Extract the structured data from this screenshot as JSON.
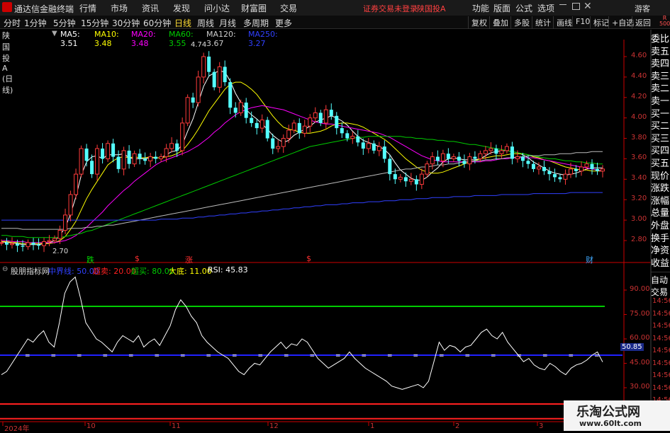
{
  "app_title": "通达信金融终端",
  "menu": [
    "行情",
    "市场",
    "资讯",
    "发现",
    "问小达",
    "财富圈",
    "交易"
  ],
  "warning": "证券交易未登录",
  "stock_title": "陕国投A",
  "right_menu": [
    "功能",
    "版面",
    "公式",
    "选项"
  ],
  "guest": "游客",
  "periods": [
    "分时",
    "1分钟",
    "5分钟",
    "15分钟",
    "30分钟",
    "60分钟",
    "日线",
    "周线",
    "月线",
    "多周期",
    "更多"
  ],
  "active_period": "日线",
  "toolbar": [
    "复权",
    "叠加",
    "多股",
    "统计",
    "画线",
    "F10",
    "标记",
    "+自选",
    "返回"
  ],
  "info": {
    "name": "陕国投A (日线)",
    "ma5": "MA5: 3.51",
    "ma10": "MA10: 3.48",
    "ma20": "MA20: 3.48",
    "ma60": "MA60: 3.55",
    "ma120": "MA120: 3.67",
    "ma250": "MA250: 3.27"
  },
  "side_labels": [
    "委比",
    "卖五",
    "卖四",
    "卖三",
    "卖二",
    "卖一",
    "买一",
    "买二",
    "买三",
    "买四",
    "买五",
    "现价",
    "涨跌",
    "涨幅",
    "总量",
    "外盘",
    "换手",
    "净资",
    "收益"
  ],
  "side_labels2": [
    "自动",
    "交易"
  ],
  "price_axis": [
    "4.60",
    "4.40",
    "4.20",
    "4.00",
    "3.80",
    "3.60",
    "3.40",
    "3.20",
    "3.00",
    "2.80"
  ],
  "rsi_axis": [
    "90.00",
    "75.00",
    "60.00",
    "45.00",
    "30.00"
  ],
  "rsi_current_tag": "50.85",
  "time_stubs": [
    "14:56",
    "14:56",
    "14:56",
    "14:56",
    "14:56",
    "14:56",
    "14:56",
    "14:56",
    "14:56",
    "14:56",
    "14:56"
  ],
  "r_badge": "R\n500",
  "markers": [
    "跌",
    "$",
    "涨",
    "$",
    "财"
  ],
  "high_label": "4.74",
  "low_label": "2.70",
  "indicator": {
    "name": "股朋指标网",
    "midline": "中界线: 50.00",
    "oversold": "超卖: 20.00",
    "overbought": "超买: 80.00",
    "bottom": "大底: 11.00",
    "rsi": "RSI: 45.83"
  },
  "x_axis": [
    "2024年",
    "10",
    "11",
    "12",
    "1",
    "2",
    "3"
  ],
  "watermark": {
    "title": "乐淘公式网",
    "url": "www.60lt.com"
  },
  "colors": {
    "up": "#ff3b3b",
    "down": "#54ffff",
    "ma5": "#ffffff",
    "ma10": "#ffff00",
    "ma20": "#ff00ff",
    "ma60": "#00cc00",
    "ma120": "#bbbbbb",
    "ma250": "#3040ff",
    "midline": "#2020ff",
    "overbought": "#00cc00",
    "oversold": "#ff2020"
  },
  "chart_data": [
    {
      "type": "candlestick",
      "title": "陕国投A (日线)",
      "ylim": [
        2.7,
        4.74
      ],
      "y_ticks": [
        4.6,
        4.4,
        4.2,
        4.0,
        3.8,
        3.6,
        3.4,
        3.2,
        3.0,
        2.8
      ],
      "x_labels": [
        "2024年",
        "10",
        "11",
        "12",
        "1",
        "2",
        "3"
      ],
      "high": 4.74,
      "low": 2.7,
      "closes": [
        2.78,
        2.76,
        2.77,
        2.75,
        2.74,
        2.78,
        2.76,
        2.75,
        2.79,
        2.8,
        2.82,
        2.9,
        3.05,
        3.25,
        3.45,
        3.7,
        3.58,
        3.45,
        3.7,
        3.6,
        3.75,
        3.62,
        3.5,
        3.68,
        3.55,
        3.65,
        3.6,
        3.58,
        3.62,
        3.6,
        3.62,
        3.7,
        3.75,
        3.68,
        3.95,
        4.2,
        4.15,
        4.4,
        4.6,
        4.45,
        4.3,
        4.5,
        4.35,
        4.1,
        4.05,
        4.15,
        4.0,
        3.95,
        3.9,
        3.98,
        3.8,
        3.7,
        3.72,
        3.8,
        3.88,
        3.95,
        3.85,
        3.92,
        4.0,
        4.05,
        3.95,
        4.08,
        4.02,
        3.9,
        3.85,
        3.8,
        3.82,
        3.76,
        3.7,
        3.75,
        3.68,
        3.72,
        3.6,
        3.45,
        3.4,
        3.42,
        3.38,
        3.4,
        3.35,
        3.45,
        3.55,
        3.62,
        3.58,
        3.65,
        3.6,
        3.62,
        3.58,
        3.55,
        3.62,
        3.6,
        3.65,
        3.68,
        3.7,
        3.65,
        3.68,
        3.72,
        3.6,
        3.62,
        3.58,
        3.55,
        3.5,
        3.52,
        3.48,
        3.45,
        3.42,
        3.4,
        3.45,
        3.5,
        3.48,
        3.52,
        3.55,
        3.5,
        3.48,
        3.5
      ],
      "series": [
        {
          "name": "MA5",
          "values": [
            2.79,
            2.78,
            2.78,
            2.77,
            2.76,
            2.76,
            2.76,
            2.76,
            2.77,
            2.78,
            2.8,
            2.85,
            2.93,
            3.06,
            3.23,
            3.44,
            3.57,
            3.62,
            3.63,
            3.6,
            3.64,
            3.64,
            3.64,
            3.65,
            3.61,
            3.6,
            3.6,
            3.6,
            3.61,
            3.61,
            3.61,
            3.64,
            3.67,
            3.68,
            3.74,
            3.87,
            3.99,
            4.15,
            4.31,
            4.41,
            4.44,
            4.46,
            4.45,
            4.36,
            4.24,
            4.15,
            4.08,
            4.03,
            3.99,
            3.94,
            3.89,
            3.83,
            3.79,
            3.76,
            3.78,
            3.83,
            3.86,
            3.89,
            3.92,
            3.96,
            3.98,
            4.0,
            4.02,
            4.0,
            3.97,
            3.93,
            3.87,
            3.82,
            3.78,
            3.76,
            3.74,
            3.72,
            3.69,
            3.64,
            3.56,
            3.49,
            3.45,
            3.41,
            3.39,
            3.39,
            3.42,
            3.47,
            3.51,
            3.57,
            3.6,
            3.61,
            3.6,
            3.59,
            3.59,
            3.59,
            3.6,
            3.63,
            3.66,
            3.67,
            3.68,
            3.68,
            3.67,
            3.66,
            3.64,
            3.61,
            3.57,
            3.54,
            3.51,
            3.48,
            3.46,
            3.45,
            3.44,
            3.45,
            3.46,
            3.48,
            3.5,
            3.51,
            3.51,
            3.51
          ]
        },
        {
          "name": "MA10",
          "values": [
            2.79,
            2.79,
            2.78,
            2.78,
            2.77,
            2.77,
            2.77,
            2.77,
            2.77,
            2.77,
            2.78,
            2.8,
            2.84,
            2.91,
            2.99,
            3.1,
            3.21,
            3.3,
            3.38,
            3.46,
            3.54,
            3.58,
            3.61,
            3.62,
            3.61,
            3.62,
            3.61,
            3.61,
            3.62,
            3.61,
            3.61,
            3.62,
            3.63,
            3.65,
            3.68,
            3.74,
            3.81,
            3.89,
            3.98,
            4.07,
            4.14,
            4.21,
            4.28,
            4.33,
            4.35,
            4.35,
            4.32,
            4.28,
            4.23,
            4.16,
            4.09,
            4.02,
            3.96,
            3.91,
            3.89,
            3.88,
            3.86,
            3.85,
            3.85,
            3.86,
            3.87,
            3.89,
            3.92,
            3.94,
            3.95,
            3.95,
            3.94,
            3.93,
            3.91,
            3.88,
            3.85,
            3.82,
            3.79,
            3.75,
            3.7,
            3.65,
            3.6,
            3.56,
            3.52,
            3.49,
            3.47,
            3.46,
            3.46,
            3.47,
            3.49,
            3.51,
            3.53,
            3.55,
            3.57,
            3.58,
            3.6,
            3.61,
            3.62,
            3.63,
            3.63,
            3.64,
            3.65,
            3.65,
            3.65,
            3.64,
            3.62,
            3.61,
            3.59,
            3.58,
            3.56,
            3.54,
            3.52,
            3.51,
            3.5,
            3.49,
            3.49,
            3.48,
            3.48,
            3.48
          ]
        },
        {
          "name": "MA20",
          "values": [
            2.8,
            2.8,
            2.79,
            2.79,
            2.79,
            2.78,
            2.78,
            2.78,
            2.78,
            2.78,
            2.78,
            2.79,
            2.8,
            2.82,
            2.85,
            2.89,
            2.93,
            2.98,
            3.03,
            3.08,
            3.14,
            3.19,
            3.24,
            3.29,
            3.33,
            3.38,
            3.42,
            3.46,
            3.5,
            3.54,
            3.57,
            3.59,
            3.61,
            3.63,
            3.65,
            3.67,
            3.7,
            3.73,
            3.77,
            3.81,
            3.86,
            3.9,
            3.95,
            3.99,
            4.03,
            4.06,
            4.08,
            4.1,
            4.11,
            4.12,
            4.11,
            4.1,
            4.09,
            4.08,
            4.06,
            4.04,
            4.02,
            4.0,
            3.98,
            3.96,
            3.95,
            3.94,
            3.94,
            3.93,
            3.92,
            3.91,
            3.9,
            3.89,
            3.88,
            3.87,
            3.86,
            3.85,
            3.83,
            3.81,
            3.78,
            3.75,
            3.72,
            3.69,
            3.66,
            3.63,
            3.61,
            3.59,
            3.58,
            3.57,
            3.57,
            3.57,
            3.57,
            3.57,
            3.57,
            3.57,
            3.57,
            3.58,
            3.58,
            3.59,
            3.6,
            3.6,
            3.61,
            3.61,
            3.61,
            3.61,
            3.61,
            3.6,
            3.59,
            3.58,
            3.57,
            3.56,
            3.55,
            3.54,
            3.53,
            3.52,
            3.51,
            3.5,
            3.49,
            3.48
          ]
        },
        {
          "name": "MA60",
          "values": [
            2.85,
            2.85,
            2.84,
            2.84,
            2.84,
            2.83,
            2.83,
            2.83,
            2.83,
            2.83,
            2.83,
            2.83,
            2.84,
            2.85,
            2.86,
            2.87,
            2.89,
            2.9,
            2.92,
            2.94,
            2.96,
            2.98,
            3.0,
            3.02,
            3.04,
            3.06,
            3.08,
            3.1,
            3.12,
            3.14,
            3.16,
            3.18,
            3.2,
            3.22,
            3.24,
            3.26,
            3.28,
            3.3,
            3.32,
            3.34,
            3.36,
            3.38,
            3.4,
            3.42,
            3.44,
            3.46,
            3.48,
            3.5,
            3.52,
            3.54,
            3.56,
            3.58,
            3.6,
            3.62,
            3.64,
            3.66,
            3.68,
            3.7,
            3.72,
            3.73,
            3.74,
            3.75,
            3.76,
            3.77,
            3.78,
            3.79,
            3.8,
            3.81,
            3.81,
            3.82,
            3.82,
            3.82,
            3.82,
            3.82,
            3.82,
            3.82,
            3.81,
            3.81,
            3.8,
            3.8,
            3.79,
            3.79,
            3.78,
            3.78,
            3.77,
            3.77,
            3.76,
            3.75,
            3.74,
            3.74,
            3.73,
            3.72,
            3.71,
            3.7,
            3.69,
            3.68,
            3.67,
            3.66,
            3.65,
            3.64,
            3.63,
            3.62,
            3.61,
            3.6,
            3.6,
            3.59,
            3.58,
            3.58,
            3.57,
            3.57,
            3.56,
            3.56,
            3.55,
            3.55
          ]
        },
        {
          "name": "MA120",
          "values": [
            2.92,
            2.92,
            2.92,
            2.92,
            2.91,
            2.91,
            2.91,
            2.91,
            2.91,
            2.91,
            2.91,
            2.91,
            2.91,
            2.92,
            2.92,
            2.92,
            2.93,
            2.93,
            2.94,
            2.94,
            2.95,
            2.95,
            2.96,
            2.97,
            2.98,
            2.99,
            3.0,
            3.01,
            3.02,
            3.03,
            3.04,
            3.05,
            3.06,
            3.07,
            3.08,
            3.09,
            3.1,
            3.11,
            3.12,
            3.13,
            3.14,
            3.15,
            3.16,
            3.17,
            3.18,
            3.19,
            3.2,
            3.21,
            3.22,
            3.23,
            3.24,
            3.25,
            3.26,
            3.27,
            3.28,
            3.29,
            3.3,
            3.31,
            3.32,
            3.33,
            3.34,
            3.35,
            3.36,
            3.37,
            3.38,
            3.39,
            3.4,
            3.41,
            3.42,
            3.43,
            3.44,
            3.45,
            3.46,
            3.47,
            3.48,
            3.49,
            3.5,
            3.5,
            3.51,
            3.52,
            3.52,
            3.53,
            3.54,
            3.54,
            3.55,
            3.55,
            3.56,
            3.57,
            3.57,
            3.58,
            3.58,
            3.59,
            3.59,
            3.6,
            3.6,
            3.61,
            3.61,
            3.62,
            3.62,
            3.63,
            3.63,
            3.63,
            3.64,
            3.64,
            3.64,
            3.65,
            3.65,
            3.65,
            3.66,
            3.66,
            3.66,
            3.67,
            3.67,
            3.67
          ]
        },
        {
          "name": "MA250",
          "values": [
            3.0,
            3.0,
            3.0,
            3.0,
            3.0,
            3.0,
            3.0,
            3.0,
            3.0,
            3.0,
            3.0,
            3.0,
            3.0,
            3.0,
            3.0,
            3.0,
            3.0,
            3.0,
            3.0,
            3.0,
            3.0,
            3.0,
            3.0,
            3.0,
            3.0,
            3.0,
            3.0,
            3.0,
            3.0,
            3.0,
            3.01,
            3.01,
            3.01,
            3.01,
            3.02,
            3.02,
            3.02,
            3.03,
            3.03,
            3.04,
            3.04,
            3.05,
            3.05,
            3.06,
            3.06,
            3.07,
            3.07,
            3.08,
            3.08,
            3.09,
            3.09,
            3.1,
            3.1,
            3.11,
            3.11,
            3.12,
            3.12,
            3.13,
            3.13,
            3.14,
            3.14,
            3.15,
            3.15,
            3.15,
            3.16,
            3.16,
            3.17,
            3.17,
            3.17,
            3.18,
            3.18,
            3.18,
            3.19,
            3.19,
            3.19,
            3.2,
            3.2,
            3.2,
            3.21,
            3.21,
            3.21,
            3.22,
            3.22,
            3.22,
            3.22,
            3.23,
            3.23,
            3.23,
            3.23,
            3.24,
            3.24,
            3.24,
            3.24,
            3.24,
            3.25,
            3.25,
            3.25,
            3.25,
            3.25,
            3.25,
            3.26,
            3.26,
            3.26,
            3.26,
            3.26,
            3.26,
            3.26,
            3.27,
            3.27,
            3.27,
            3.27,
            3.27,
            3.27,
            3.27
          ]
        }
      ]
    },
    {
      "type": "line",
      "title": "股朋指标网",
      "ylim": [
        25,
        100
      ],
      "y_ticks": [
        90,
        75,
        60,
        45,
        30
      ],
      "series": [
        {
          "name": "RSI",
          "values": [
            38,
            40,
            45,
            50,
            55,
            60,
            58,
            62,
            65,
            58,
            55,
            70,
            88,
            95,
            98,
            85,
            70,
            65,
            60,
            58,
            55,
            52,
            58,
            62,
            60,
            58,
            62,
            55,
            58,
            60,
            56,
            62,
            68,
            78,
            84,
            80,
            74,
            70,
            62,
            58,
            55,
            52,
            50,
            48,
            44,
            40,
            38,
            42,
            45,
            44,
            48,
            52,
            55,
            58,
            54,
            57,
            56,
            60,
            58,
            53,
            48,
            45,
            42,
            44,
            46,
            48,
            52,
            48,
            45,
            42,
            40,
            38,
            36,
            34,
            31,
            30,
            29,
            30,
            31,
            32,
            30,
            34,
            46,
            58,
            53,
            56,
            55,
            52,
            55,
            56,
            60,
            64,
            66,
            62,
            60,
            64,
            58,
            54,
            50,
            46,
            48,
            44,
            42,
            41,
            45,
            43,
            40,
            38,
            42,
            44,
            45,
            47,
            50,
            52,
            45.83
          ]
        },
        {
          "name": "中界线",
          "values": [
            50
          ]
        },
        {
          "name": "超卖",
          "values": [
            20
          ]
        },
        {
          "name": "超买",
          "values": [
            80
          ]
        },
        {
          "name": "大底",
          "values": [
            11
          ]
        }
      ]
    }
  ]
}
